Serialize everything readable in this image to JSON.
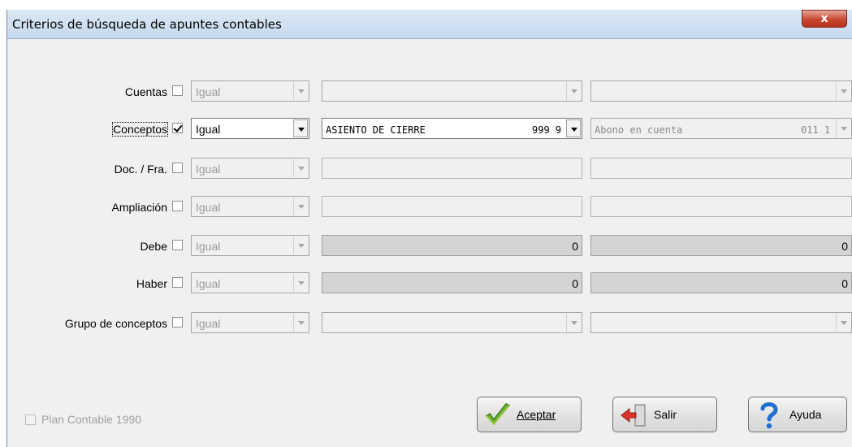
{
  "window": {
    "title": "Criterios de búsqueda de apuntes contables",
    "close_label": "x"
  },
  "rows": [
    {
      "label": "Cuentas",
      "checked": false,
      "op": "Igual"
    },
    {
      "label": "Conceptos",
      "checked": true,
      "op": "Igual",
      "field1_text": "ASIENTO DE CIERRE",
      "field1_code": "999 9",
      "field2_text": "Abono en cuenta",
      "field2_code": "011 1"
    },
    {
      "label": "Doc. / Fra.",
      "checked": false,
      "op": "Igual"
    },
    {
      "label": "Ampliación",
      "checked": false,
      "op": "Igual"
    },
    {
      "label": "Debe",
      "checked": false,
      "op": "Igual",
      "value1": "0",
      "value2": "0"
    },
    {
      "label": "Haber",
      "checked": false,
      "op": "Igual",
      "value1": "0",
      "value2": "0"
    },
    {
      "label": "Grupo de conceptos",
      "checked": false,
      "op": "Igual"
    }
  ],
  "footer": {
    "plan_label": "Plan Contable 1990",
    "plan_checked": false
  },
  "buttons": {
    "accept": "Aceptar",
    "exit": "Salir",
    "help": "Ayuda"
  }
}
